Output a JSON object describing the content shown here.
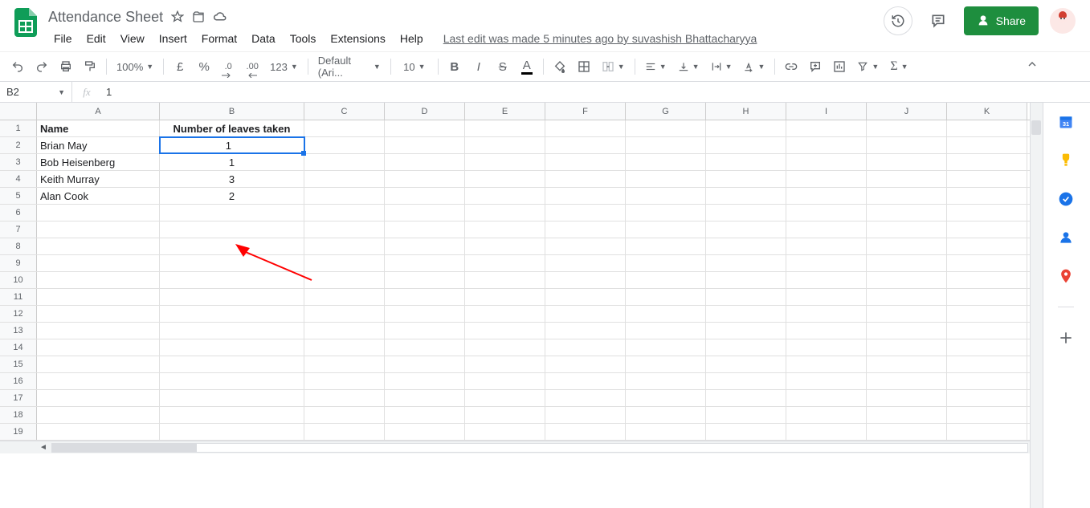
{
  "doc": {
    "title": "Attendance Sheet"
  },
  "menu": {
    "file": "File",
    "edit": "Edit",
    "view": "View",
    "insert": "Insert",
    "format": "Format",
    "data": "Data",
    "tools": "Tools",
    "extensions": "Extensions",
    "help": "Help",
    "last_edit": "Last edit was made 5 minutes ago by suvashish Bhattacharyya"
  },
  "header": {
    "share": "Share"
  },
  "toolbar": {
    "zoom": "100%",
    "currency": "£",
    "percent": "%",
    "dec_dec": ".0",
    "inc_dec": ".00",
    "numfmt": "123",
    "font": "Default (Ari...",
    "size": "10"
  },
  "formula": {
    "cell_ref": "B2",
    "value": "1"
  },
  "columns": [
    "A",
    "B",
    "C",
    "D",
    "E",
    "F",
    "G",
    "H",
    "I",
    "J",
    "K"
  ],
  "rows_visible": 19,
  "grid": {
    "headers": {
      "a": "Name",
      "b": "Number of leaves taken"
    },
    "data": [
      {
        "name": "Brian May",
        "leaves": "1"
      },
      {
        "name": "Bob Heisenberg",
        "leaves": "1"
      },
      {
        "name": "Keith  Murray",
        "leaves": "3"
      },
      {
        "name": "Alan Cook",
        "leaves": "2"
      }
    ]
  },
  "selected_cell": "B2"
}
